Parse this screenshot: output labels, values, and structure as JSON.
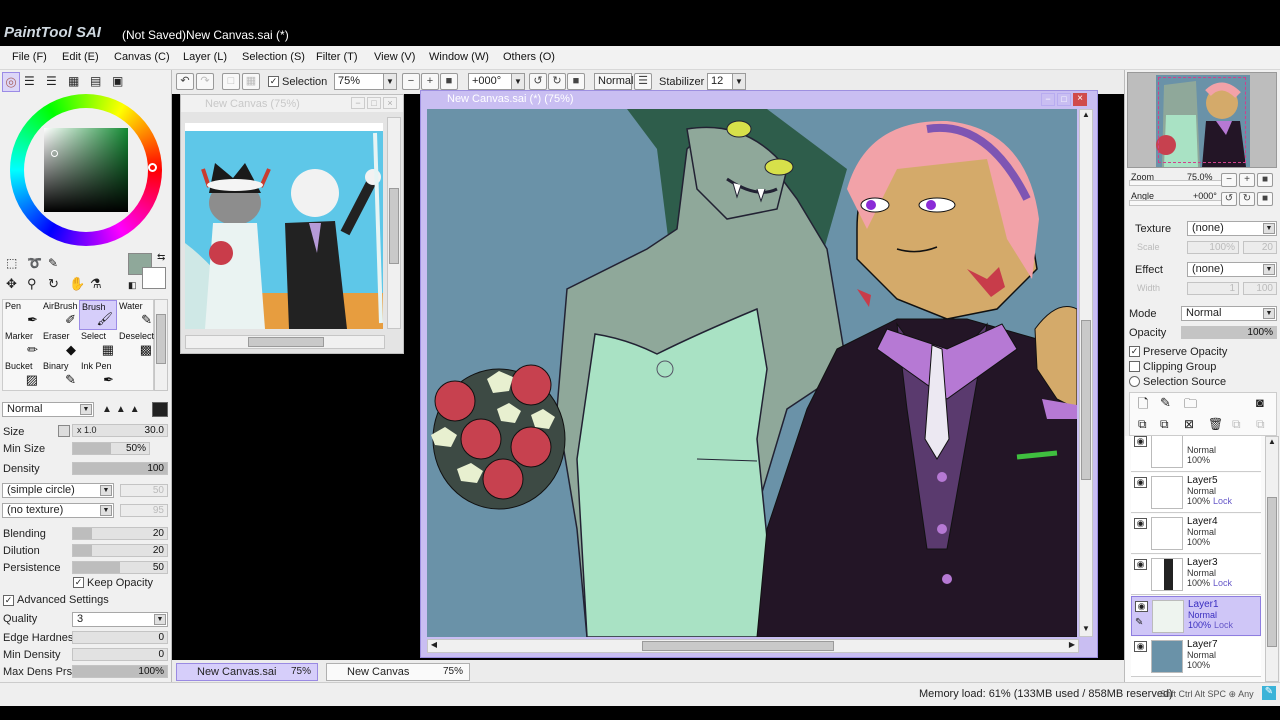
{
  "app": {
    "logo": "PaintTool SAI",
    "title": "(Not Saved)New Canvas.sai (*)"
  },
  "menu": [
    "File (F)",
    "Edit (E)",
    "Canvas (C)",
    "Layer (L)",
    "Selection (S)",
    "Filter (T)",
    "View (V)",
    "Window (W)",
    "Others (O)"
  ],
  "toolbar": {
    "selection_label": "Selection",
    "zoom": "75%",
    "angle": "+000°",
    "blend_mode": "Normal",
    "stabilizer_label": "Stabilizer",
    "stabilizer_value": "12"
  },
  "tools": [
    {
      "label": "Pen"
    },
    {
      "label": "AirBrush"
    },
    {
      "label": "Brush"
    },
    {
      "label": "Water"
    },
    {
      "label": "Marker"
    },
    {
      "label": "Eraser"
    },
    {
      "label": "Select"
    },
    {
      "label": "Deselect"
    },
    {
      "label": "Bucket"
    },
    {
      "label": "Binary"
    },
    {
      "label": "Ink Pen"
    },
    {
      "label": ""
    }
  ],
  "brush": {
    "mode": "Normal",
    "size_label": "Size",
    "size_mult": "x 1.0",
    "size_value": "30.0",
    "minsize_label": "Min Size",
    "minsize_value": "50%",
    "minsize_fraction": 0.5,
    "density_label": "Density",
    "density_value": "100",
    "shape": "(simple circle)",
    "shape_value": "50",
    "texture": "(no texture)",
    "texture_value": "95",
    "blending_label": "Blending",
    "blending_value": "20",
    "dilution_label": "Dilution",
    "dilution_value": "20",
    "persistence_label": "Persistence",
    "persistence_value": "50",
    "keep_opacity_label": "Keep Opacity",
    "advanced_label": "Advanced Settings",
    "quality_label": "Quality",
    "quality_value": "3",
    "edge_label": "Edge Hardness",
    "edge_value": "0",
    "mindensity_label": "Min Density",
    "mindensity_value": "0",
    "maxdens_label": "Max Dens Prs.",
    "maxdens_value": "100%"
  },
  "colors": {
    "primary": "#8fa89a",
    "secondary": "#ffffff",
    "accent": "#9b8be6"
  },
  "nav_window": {
    "title": "New Canvas (75%)"
  },
  "canvas_window": {
    "title": "New Canvas.sai (*) (75%)"
  },
  "navigator": {
    "zoom_label": "Zoom",
    "zoom_value": "75.0%",
    "angle_label": "Angle",
    "angle_value": "+000°"
  },
  "layer_props": {
    "texture_label": "Texture",
    "texture_value": "(none)",
    "scale_label": "Scale",
    "scale_value": "100%",
    "scale_num": "20",
    "effect_label": "Effect",
    "effect_value": "(none)",
    "width_label": "Width",
    "width_value": "1",
    "width_num": "100",
    "mode_label": "Mode",
    "mode_value": "Normal",
    "opacity_label": "Opacity",
    "opacity_value": "100%",
    "preserve_label": "Preserve Opacity",
    "clipping_label": "Clipping Group",
    "source_label": "Selection Source"
  },
  "layers": [
    {
      "name": "",
      "mode": "Normal",
      "opacity": "100%",
      "lock": ""
    },
    {
      "name": "Layer5",
      "mode": "Normal",
      "opacity": "100%",
      "lock": "Lock"
    },
    {
      "name": "Layer4",
      "mode": "Normal",
      "opacity": "100%",
      "lock": ""
    },
    {
      "name": "Layer3",
      "mode": "Normal",
      "opacity": "100%",
      "lock": "Lock"
    },
    {
      "name": "Layer1",
      "mode": "Normal",
      "opacity": "100%",
      "lock": "Lock"
    },
    {
      "name": "Layer7",
      "mode": "Normal",
      "opacity": "100%",
      "lock": ""
    }
  ],
  "tabs": [
    {
      "name": "New Canvas.sai",
      "zoom": "75%"
    },
    {
      "name": "New Canvas",
      "zoom": "75%"
    }
  ],
  "status": {
    "memory": "Memory load: 61% (133MB used / 858MB reserved)",
    "keys": "Shft Ctrl Alt SPC ⊕ Any"
  }
}
